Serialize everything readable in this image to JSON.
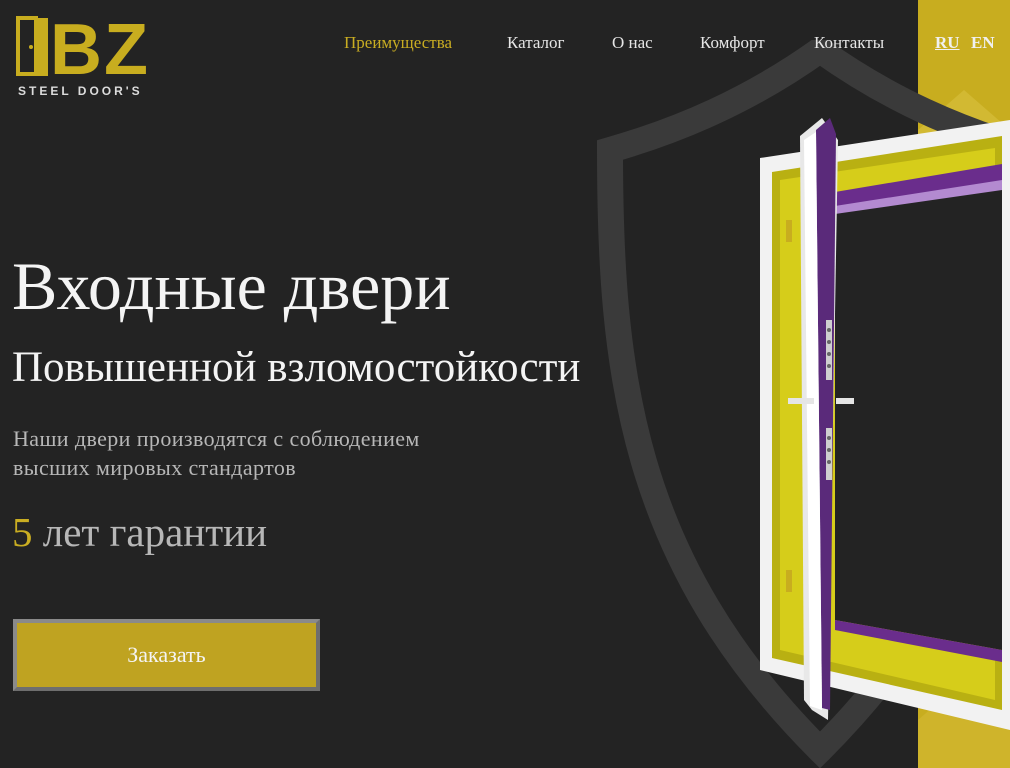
{
  "brand": {
    "logo_letters": "BZ",
    "logo_subtitle": "STEEL DOOR'S"
  },
  "nav": {
    "items": [
      {
        "label": "Преимущества",
        "active": true
      },
      {
        "label": "Каталог",
        "active": false
      },
      {
        "label": "О нас",
        "active": false
      },
      {
        "label": "Комфорт",
        "active": false
      },
      {
        "label": "Контакты",
        "active": false
      }
    ],
    "languages": [
      {
        "label": "RU",
        "active": true
      },
      {
        "label": "EN",
        "active": false
      }
    ]
  },
  "hero": {
    "title": "Входные двери",
    "subtitle": "Повышенной взломостойкости",
    "description_line1": "Наши двери производятся с соблюдением",
    "description_line2": "высших мировых стандартов",
    "warranty_number": "5",
    "warranty_text": "лет гарантии",
    "order_button": "Заказать"
  },
  "colors": {
    "background": "#232323",
    "accent_yellow": "#c8ad1f",
    "text_light": "#f4f4f4",
    "text_muted": "#b7b7b7",
    "door_purple": "#5a2a7a"
  },
  "icons": [
    "door-logo-icon",
    "shield-background",
    "open-door-illustration"
  ]
}
